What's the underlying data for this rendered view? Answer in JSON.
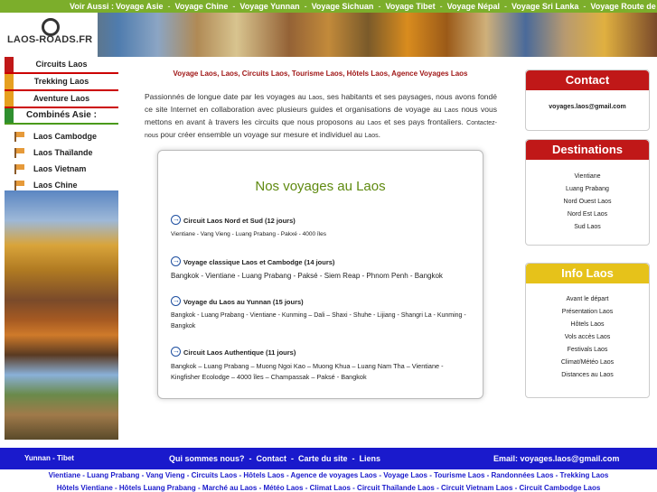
{
  "topbar": {
    "lead": "Voir Aussi :",
    "links": [
      "Voyage Asie",
      "Voyage Chine",
      "Voyage Yunnan",
      "Voyage Sichuan",
      "Voyage Tibet",
      "Voyage Népal",
      "Voyage Sri Lanka",
      "Voyage Route de la Soie"
    ]
  },
  "logo": {
    "text": "LAOS-ROADS.FR"
  },
  "sidebar": {
    "items": [
      {
        "label": "Circuits Laos",
        "color": "#c01818"
      },
      {
        "label": "Trekking Laos",
        "color": "#e6a020"
      },
      {
        "label": "Aventure Laos",
        "color": "#e6a020"
      }
    ],
    "heading": "Combinés Asie :",
    "countries": [
      "Laos Cambodge",
      "Laos Thaïlande",
      "Laos Vietnam",
      "Laos Chine"
    ]
  },
  "main": {
    "title": "Voyage Laos, Laos, Circuits Laos, Tourisme Laos, Hôtels Laos, Agence Voyages Laos",
    "intro": [
      {
        "t": "Passionnés de longue date par les voyages au ",
        "sm": false
      },
      {
        "t": "Laos",
        "sm": true
      },
      {
        "t": ", ses habitants et ses paysages, nous avons fondé ce site Internet en collaboration avec plusieurs guides et organisations de voyage au ",
        "sm": false
      },
      {
        "t": "Laos",
        "sm": true
      },
      {
        "t": " nous vous mettons en avant à travers les circuits que nous proposons au ",
        "sm": false
      },
      {
        "t": "Laos",
        "sm": true
      },
      {
        "t": " et ses pays frontaliers. ",
        "sm": false
      },
      {
        "t": "Contactez-nous",
        "sm": true
      },
      {
        "t": " pour créer ensemble un voyage sur mesure et individuel au ",
        "sm": false
      },
      {
        "t": "Laos",
        "sm": true
      },
      {
        "t": ".",
        "sm": false
      }
    ],
    "voyages_title": "Nos voyages au Laos",
    "trips": [
      {
        "name": "Circuit Laos Nord et Sud (12 jours)",
        "route": "Vientiane - Vang Vieng - Luang Prabang - Pakxé - 4000 îles"
      },
      {
        "name": "Voyage classique Laos et Cambodge (14 jours)",
        "route": "Bangkok - Vientiane - Luang Prabang - Paksé - Siem Reap - Phnom Penh - Bangkok"
      },
      {
        "name": "Voyage du Laos au Yunnan (15 jours)",
        "route": "Bangkok - Luang Prabang - Vientiane - Kunming – Dali – Shaxi - Shuhe - Lijiang - Shangri La - Kunming - Bangkok"
      },
      {
        "name": "Circuit Laos Authentique (11 jours)",
        "route": "Bangkok – Luang Prabang – Muong Ngoi Kao – Muong Khua – Luang Nam Tha – Vientiane - Kingfisher Ecolodge – 4000 îles – Champassak – Paksé - Bangkok"
      }
    ]
  },
  "right": {
    "contact": {
      "title": "Contact",
      "email": "voyages.laos@gmail.com",
      "color": "#c01818"
    },
    "destinations": {
      "title": "Destinations",
      "items": [
        "Vientiane",
        "Luang Prabang",
        "Nord Ouest Laos",
        "Nord Est Laos",
        "Sud Laos"
      ],
      "color": "#c01818"
    },
    "info": {
      "title": "Info Laos",
      "items": [
        "Avant le départ",
        "Présentation Laos",
        "Hôtels Laos",
        "Vols accès Laos",
        "Festivals Laos",
        "Climat/Météo Laos",
        "Distances au Laos"
      ],
      "color": "#e6c21a"
    }
  },
  "footer": {
    "left": "Yunnan - Tibet",
    "links": [
      "Qui sommes nous?",
      "Contact",
      "Carte du site",
      "Liens"
    ],
    "email": "Email: voyages.laos@gmail.com",
    "line1": "Vientiane - Luang Prabang - Vang Vieng - Circuits Laos - Hôtels Laos - Agence de voyages Laos - Voyage Laos - Tourisme Laos - Randonnées Laos - Trekking Laos",
    "line2": "Hôtels Vientiane - Hôtels Luang Prabang - Marché au Laos - Météo Laos - Climat Laos - Circuit Thaïlande Laos - Circuit Vietnam Laos - Circuit Cambodge Laos",
    "bg": "#1a1acc"
  }
}
